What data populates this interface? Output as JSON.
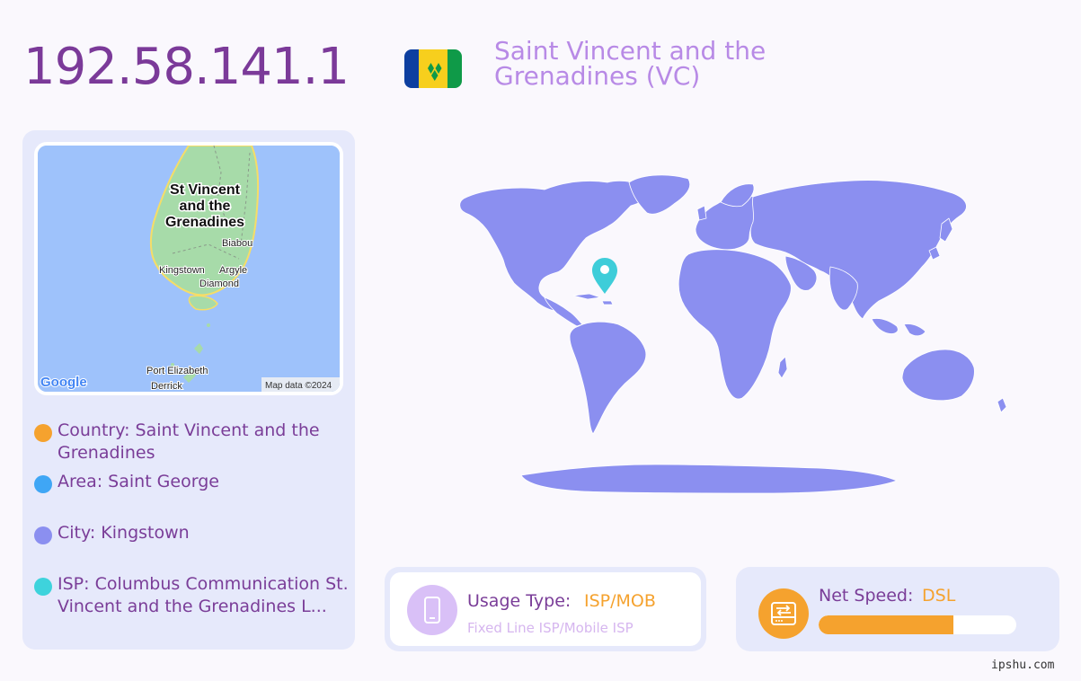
{
  "header": {
    "ip": "192.58.141.1",
    "country_title": "Saint Vincent and the Grenadines (VC)"
  },
  "map": {
    "labels": {
      "island": [
        "St Vincent",
        "and the",
        "Grenadines"
      ],
      "biabou": "Biabou",
      "kingstown": "Kingstown",
      "argyle": "Argyle",
      "diamond": "Diamond",
      "port_elizabeth": "Port Elizabeth",
      "derrick": "Derrick",
      "google": "Google",
      "attribution": "Map data ©2024"
    }
  },
  "info": {
    "country": "Country: Saint Vincent and the Grenadines",
    "area": "Area: Saint George",
    "city": "City: Kingstown",
    "isp": "ISP: Columbus Communication St. Vincent and the Grenadines L..."
  },
  "usage": {
    "label": "Usage Type:",
    "value": "ISP/MOB",
    "sub": "Fixed Line ISP/Mobile ISP"
  },
  "speed": {
    "label": "Net Speed:",
    "value": "DSL",
    "level_percent": 68
  },
  "watermark": "ipshu.com",
  "colors": {
    "title_purple": "#7b3a99",
    "country_lilac": "#b88ae6",
    "card_bg": "#e6e9fb",
    "accent_orange": "#f5a22e",
    "dot_country": "#f5a22e",
    "dot_area": "#3fa6f5",
    "dot_city": "#8b8ff0",
    "dot_isp": "#3ed3dc",
    "world_fill": "#8b8ff0",
    "pin": "#3ecdd9"
  },
  "icons": {
    "usage": "mobile-phone-icon",
    "speed": "network-device-icon",
    "pin": "map-pin-icon"
  }
}
